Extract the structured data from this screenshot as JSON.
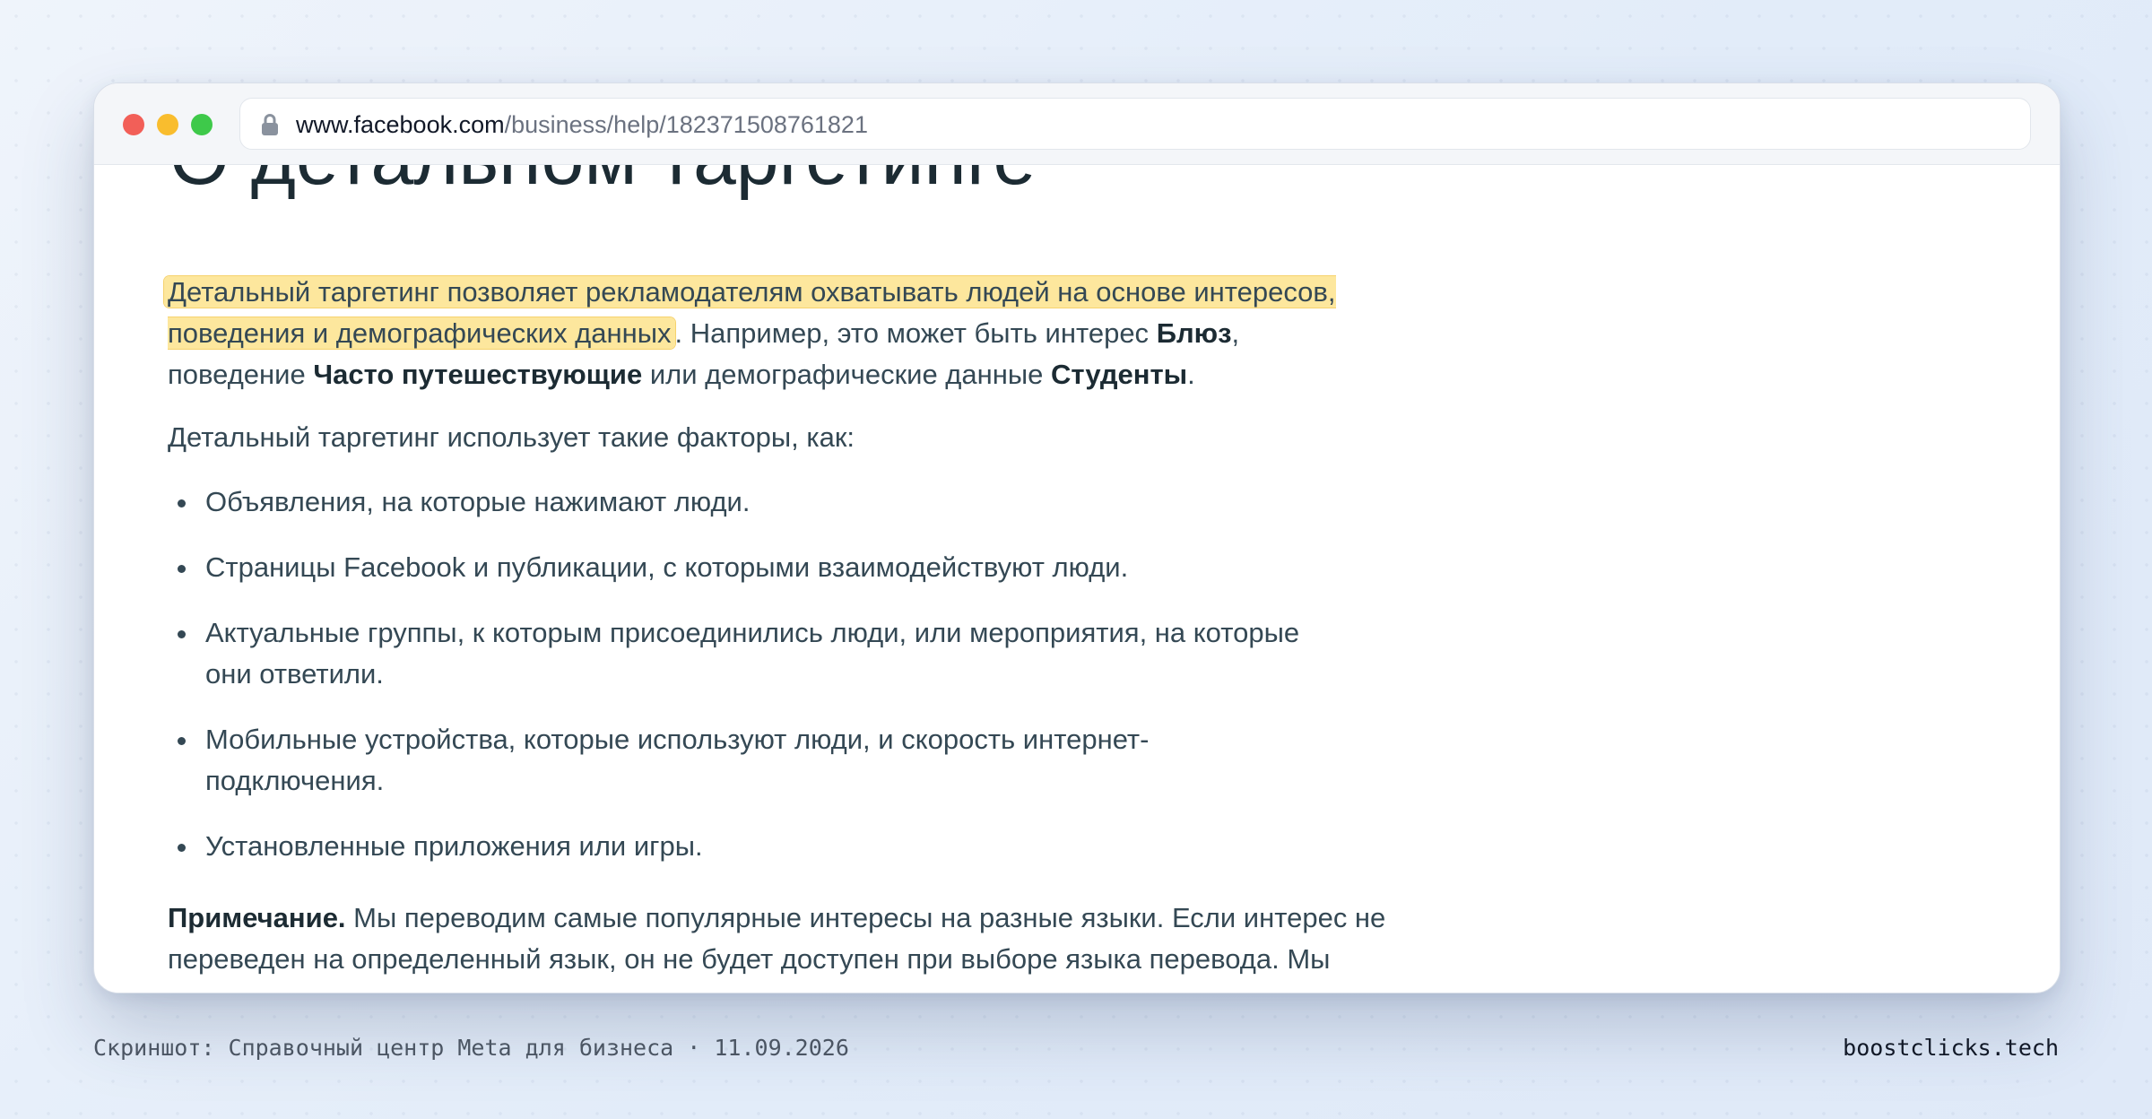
{
  "browser": {
    "url_host": "www.facebook.com",
    "url_path": "/business/help/182371508761821"
  },
  "article": {
    "title_fragment": "О детальном таргетинге",
    "intro": {
      "highlight_line1": "Детальный таргетинг позволяет рекламодателям охватывать людей на основе интересов,",
      "highlight_line2": "поведения и демографических данных",
      "after_highlight": ". Например, это может быть интерес ",
      "bold_interest": "Блюз",
      "comma_behavior": ",",
      "behavior_prefix": "поведение ",
      "bold_behavior": "Часто путешествующие",
      "demo_prefix": " или демографические данные ",
      "bold_demo": "Студенты",
      "end": "."
    },
    "factors_lead": "Детальный таргетинг использует такие факторы, как:",
    "factors": [
      "Объявления, на которые нажимают люди.",
      "Страницы Facebook и публикации, с которыми взаимодействуют люди.",
      "Актуальные группы, к которым присоединились люди, или мероприятия, на которые они ответили.",
      "Мобильные устройства, которые используют люди, и скорость интернет-подключения.",
      "Установленные приложения или игры."
    ],
    "note_label": "Примечание.",
    "note_text": " Мы переводим самые популярные интересы на разные языки. Если интерес не переведен на определенный язык, он не будет доступен при выборе языка перевода. Мы"
  },
  "footer": {
    "caption": "Скриншот: Справочный центр Meta для бизнеса · 11.09.2026",
    "brand": "boostclicks.tech"
  }
}
